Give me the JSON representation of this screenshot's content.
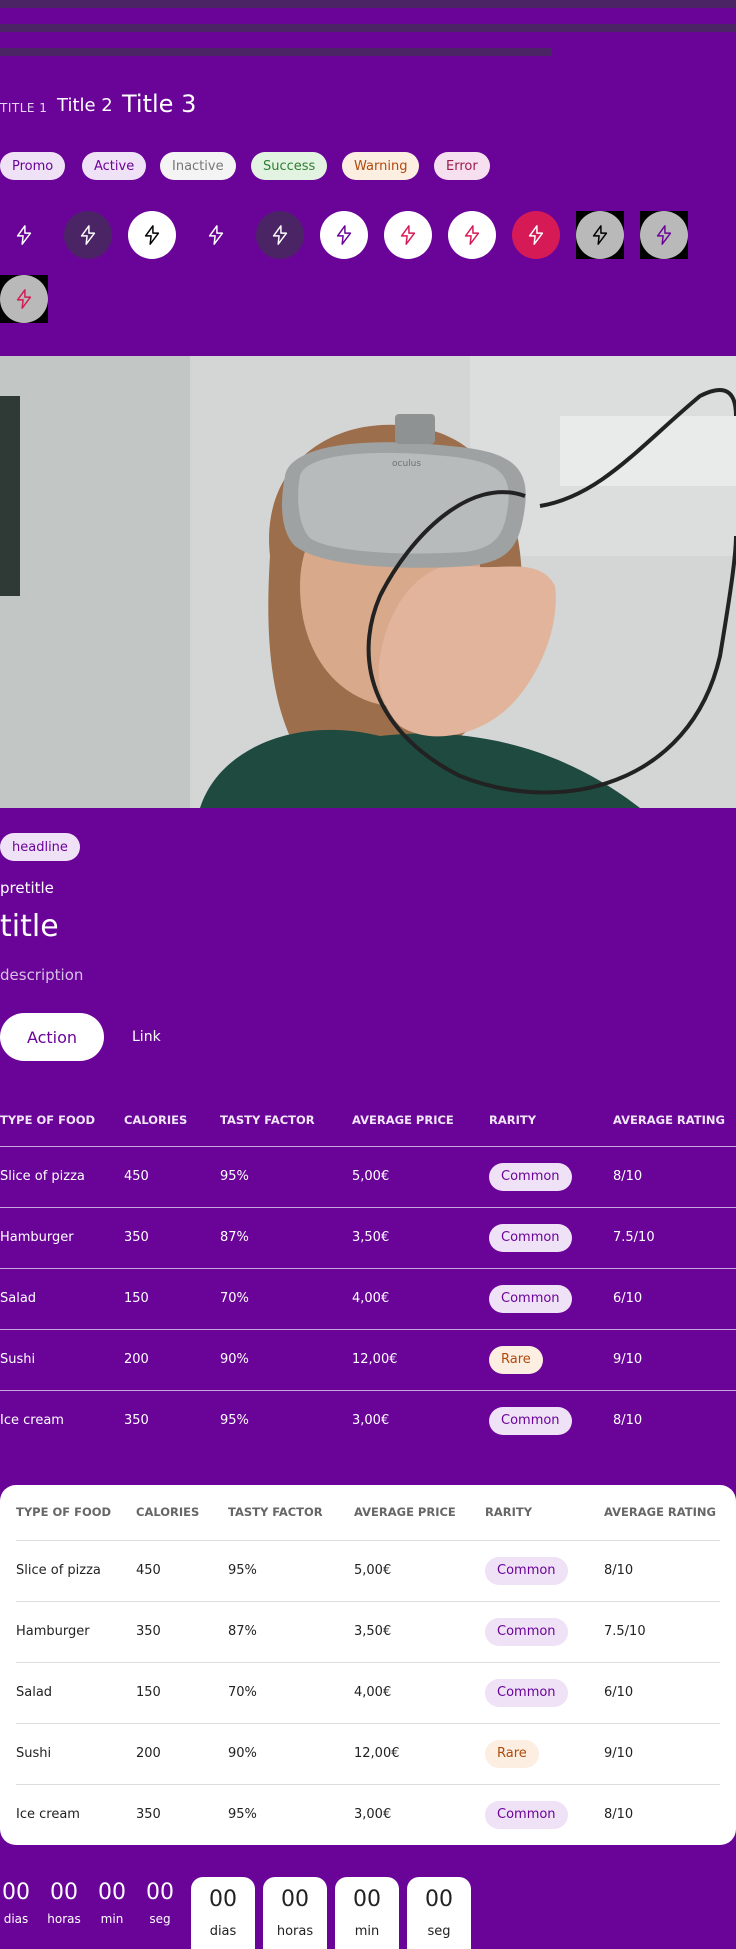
{
  "progress": [
    {
      "name": "progress-bar-1",
      "value": 1.0
    },
    {
      "name": "progress-bar-2",
      "value": 1.0
    },
    {
      "name": "progress-bar-3",
      "value": 0.75
    }
  ],
  "titles": {
    "t1": "Title 1",
    "t2": "Title 2",
    "t3": "Title 3"
  },
  "badges": [
    "Promo",
    "Active",
    "Inactive",
    "Success",
    "Warning",
    "Error"
  ],
  "icon_buttons": [
    {
      "icon": "bolt-icon",
      "bg": "transparent",
      "stroke": "#ffffff"
    },
    {
      "icon": "bolt-icon",
      "bg": "#4b2466",
      "stroke": "#ffffff"
    },
    {
      "icon": "bolt-icon",
      "bg": "#ffffff",
      "stroke": "#000000"
    },
    {
      "icon": "bolt-icon",
      "bg": "transparent",
      "stroke": "#ffffff"
    },
    {
      "icon": "bolt-icon",
      "bg": "#4b2466",
      "stroke": "#ffffff"
    },
    {
      "icon": "bolt-icon",
      "bg": "#ffffff",
      "stroke": "#6a0499"
    },
    {
      "icon": "bolt-icon",
      "bg": "#ffffff",
      "stroke": "#d61a55"
    },
    {
      "icon": "bolt-icon",
      "bg": "#ffffff",
      "stroke": "#d61a55"
    },
    {
      "icon": "bolt-icon",
      "bg": "#d61a55",
      "stroke": "#ffffff"
    },
    {
      "icon": "bolt-icon",
      "bg": "#b9b9b9",
      "stroke": "#000000",
      "square": true
    },
    {
      "icon": "bolt-icon",
      "bg": "#b9b9b9",
      "stroke": "#6a0499",
      "square": true
    },
    {
      "icon": "bolt-icon",
      "bg": "#b9b9b9",
      "stroke": "#d61a55",
      "square": true
    }
  ],
  "card": {
    "headline": "headline",
    "pretitle": "pretitle",
    "title": "title",
    "description": "description",
    "action": "Action",
    "link": "Link"
  },
  "table": {
    "headers": [
      "TYPE OF FOOD",
      "CALORIES",
      "TASTY FACTOR",
      "AVERAGE PRICE",
      "RARITY",
      "AVERAGE RATING"
    ],
    "rows": [
      [
        "Slice of pizza",
        "450",
        "95%",
        "5,00€",
        "Common",
        "8/10"
      ],
      [
        "Hamburger",
        "350",
        "87%",
        "3,50€",
        "Common",
        "7.5/10"
      ],
      [
        "Salad",
        "150",
        "70%",
        "4,00€",
        "Common",
        "6/10"
      ],
      [
        "Sushi",
        "200",
        "90%",
        "12,00€",
        "Rare",
        "9/10"
      ],
      [
        "Ice cream",
        "350",
        "95%",
        "3,00€",
        "Common",
        "8/10"
      ]
    ]
  },
  "countdown": {
    "plain": [
      {
        "value": "00",
        "label": "dias"
      },
      {
        "value": "00",
        "label": "horas"
      },
      {
        "value": "00",
        "label": "min"
      },
      {
        "value": "00",
        "label": "seg"
      }
    ],
    "boxed": [
      {
        "value": "00",
        "label": "dias"
      },
      {
        "value": "00",
        "label": "horas"
      },
      {
        "value": "00",
        "label": "min"
      },
      {
        "value": "00",
        "label": "seg"
      }
    ]
  },
  "colors": {
    "background": "#6a0499",
    "dark_purple": "#4b2466",
    "error_red": "#d61a55"
  }
}
